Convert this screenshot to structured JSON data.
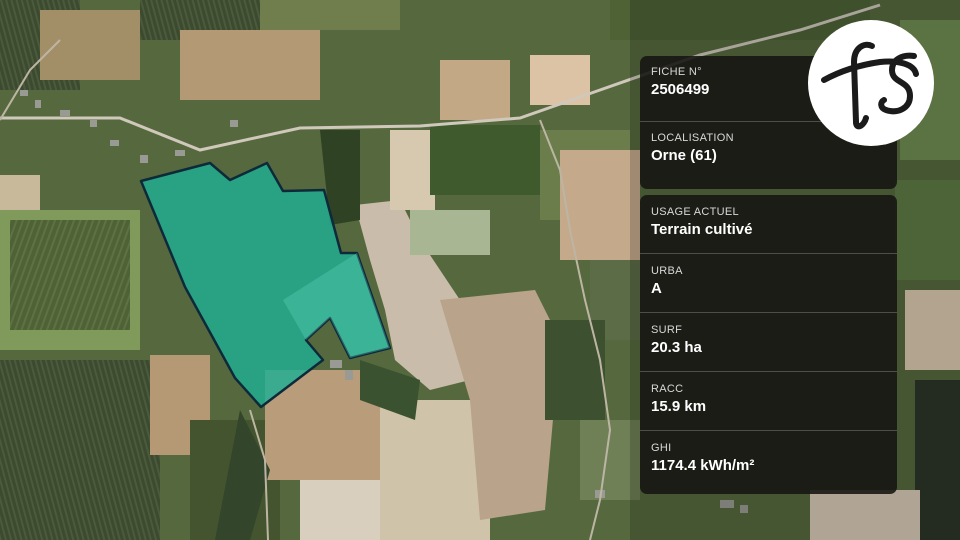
{
  "map": {
    "type": "satellite-aerial",
    "parcel_fill": "#1fae92",
    "parcel_outline": "#0e2a3a"
  },
  "logo": {
    "text": "fs",
    "icon": "fs-monogram-logo",
    "background": "#ffffff",
    "foreground": "#1b1b1b"
  },
  "info": {
    "fiche_label": "FICHE N°",
    "fiche_value": "2506499",
    "localisation_label": "LOCALISATION",
    "localisation_value": "Orne (61)",
    "usage_label": "USAGE ACTUEL",
    "usage_value": "Terrain cultivé",
    "urba_label": "URBA",
    "urba_value": "A",
    "surf_label": "SURF",
    "surf_value": "20.3 ha",
    "racc_label": "RACC",
    "racc_value": "15.9 km",
    "ghi_label": "GHI",
    "ghi_value": "1174.4 kWh/m²"
  }
}
